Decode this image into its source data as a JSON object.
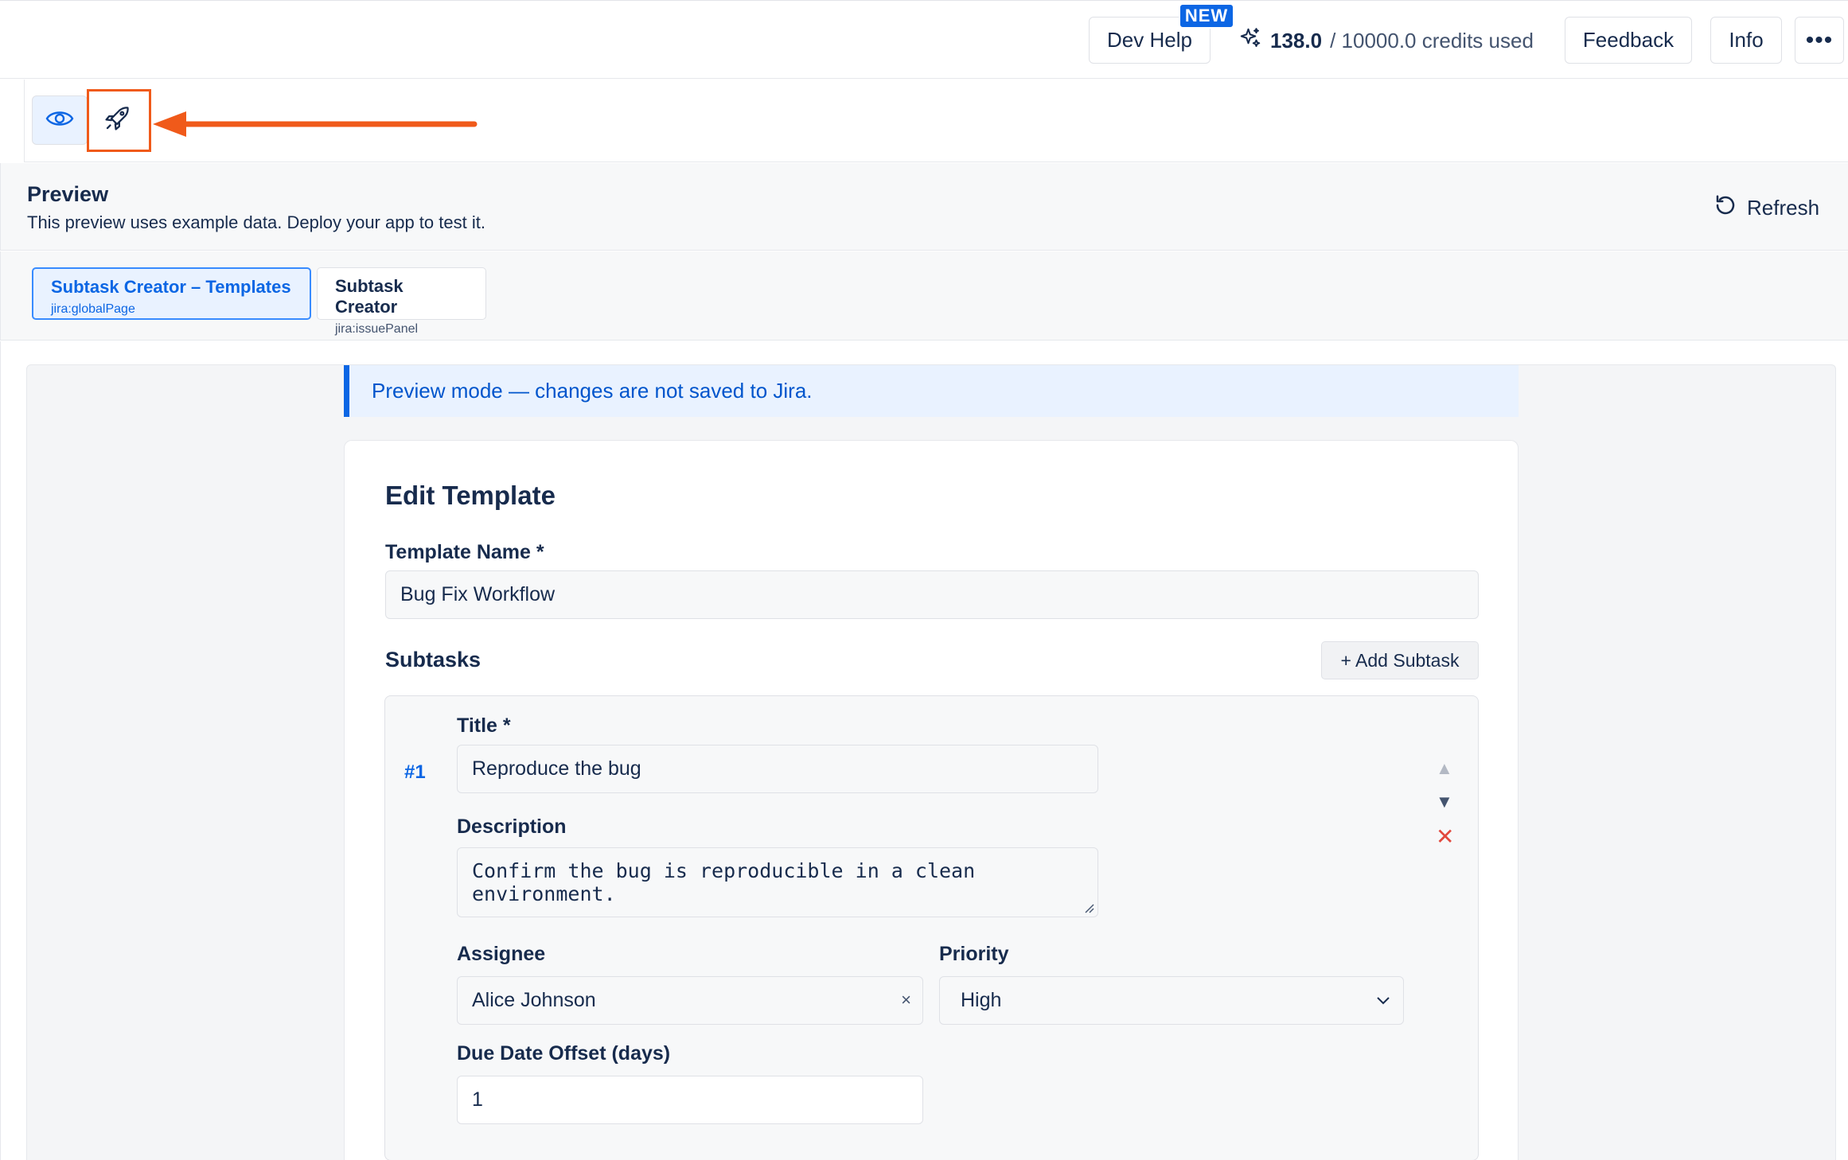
{
  "topbar": {
    "dev_help": "Dev Help",
    "new_badge": "NEW",
    "credits_used": "138.0",
    "credits_rest": "/ 10000.0 credits used",
    "feedback": "Feedback",
    "info": "Info",
    "more": "•••"
  },
  "preview": {
    "title": "Preview",
    "subtitle": "This preview uses example data. Deploy your app to test it.",
    "refresh": "Refresh"
  },
  "modules": [
    {
      "label": "Subtask Creator – Templates",
      "key": "jira:globalPage"
    },
    {
      "label": "Subtask Creator",
      "key": "jira:issuePanel"
    }
  ],
  "banner": "Preview mode — changes are not saved to Jira.",
  "form": {
    "title": "Edit Template",
    "template_name_label": "Template Name *",
    "template_name_value": "Bug Fix Workflow",
    "subtasks_label": "Subtasks",
    "add_subtask": "+ Add Subtask",
    "subtask": {
      "number": "#1",
      "title_label": "Title *",
      "title_value": "Reproduce the bug",
      "description_label": "Description",
      "description_value": "Confirm the bug is reproducible in a clean environment.",
      "assignee_label": "Assignee",
      "assignee_value": "Alice Johnson",
      "clear": "×",
      "priority_label": "Priority",
      "priority_value": "High",
      "due_label": "Due Date Offset (days)",
      "due_value": "1",
      "up": "▲",
      "down": "▼",
      "remove": "✕"
    }
  },
  "colors": {
    "accent": "#0c66e4",
    "highlight": "#f05a1a",
    "danger": "#e2483d"
  }
}
